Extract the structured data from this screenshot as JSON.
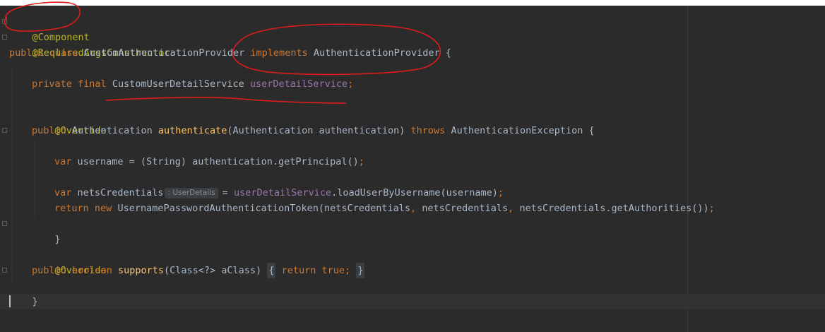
{
  "editor": {
    "lines": {
      "l1_annotation": "@Component",
      "l2_annotation": "@RequiredArgsConstructor",
      "l3": {
        "kw1": "public",
        "kw2": "class",
        "class_name": "CustomAuthenticationProvider",
        "kw3": "implements",
        "iface": "AuthenticationProvider",
        "brace": "{"
      },
      "l5": {
        "kw1": "private",
        "kw2": "final",
        "type": "CustomUserDetailService",
        "field": "userDetailService",
        "semi": ";"
      },
      "l7_annotation": "@Override",
      "l8": {
        "kw1": "public",
        "ret": "Authentication",
        "method": "authenticate",
        "params": "(Authentication authentication)",
        "kw2": "throws",
        "exc": "AuthenticationException",
        "brace": "{"
      },
      "l10": {
        "kw": "var",
        "rest": "username = (String) authentication.getPrincipal()",
        "semi": ";"
      },
      "l12": {
        "kw": "var",
        "var_name": "netsCredentials",
        "hint": ": UserDetails",
        "eq": "=",
        "field": "userDetailService",
        "call": ".loadUserByUsername(username)",
        "semi": ";"
      },
      "l13": {
        "kw1": "return",
        "kw2": "new",
        "p1": "UsernamePasswordAuthenticationToken(netsCredentials",
        "c1": ",",
        "p2": "netsCredentials",
        "c2": ",",
        "p3": "netsCredentials.getAuthorities())",
        "semi": ";"
      },
      "l14_close": "}",
      "l16_annotation": "@Override",
      "l17": {
        "kw1": "public",
        "kw2": "boolean",
        "method": "supports",
        "params": "(Class<?> aClass)",
        "open": "{",
        "kw3": "return",
        "kw4": "true",
        "semi": ";",
        "close": "}"
      },
      "l18_close": "}"
    },
    "colors": {
      "background": "#2b2b2b",
      "keyword": "#cc7832",
      "annotation": "#bbb529",
      "field": "#9876aa",
      "method": "#ffc66d",
      "text": "#a9b7c6",
      "markup": "#e01b1b"
    }
  }
}
